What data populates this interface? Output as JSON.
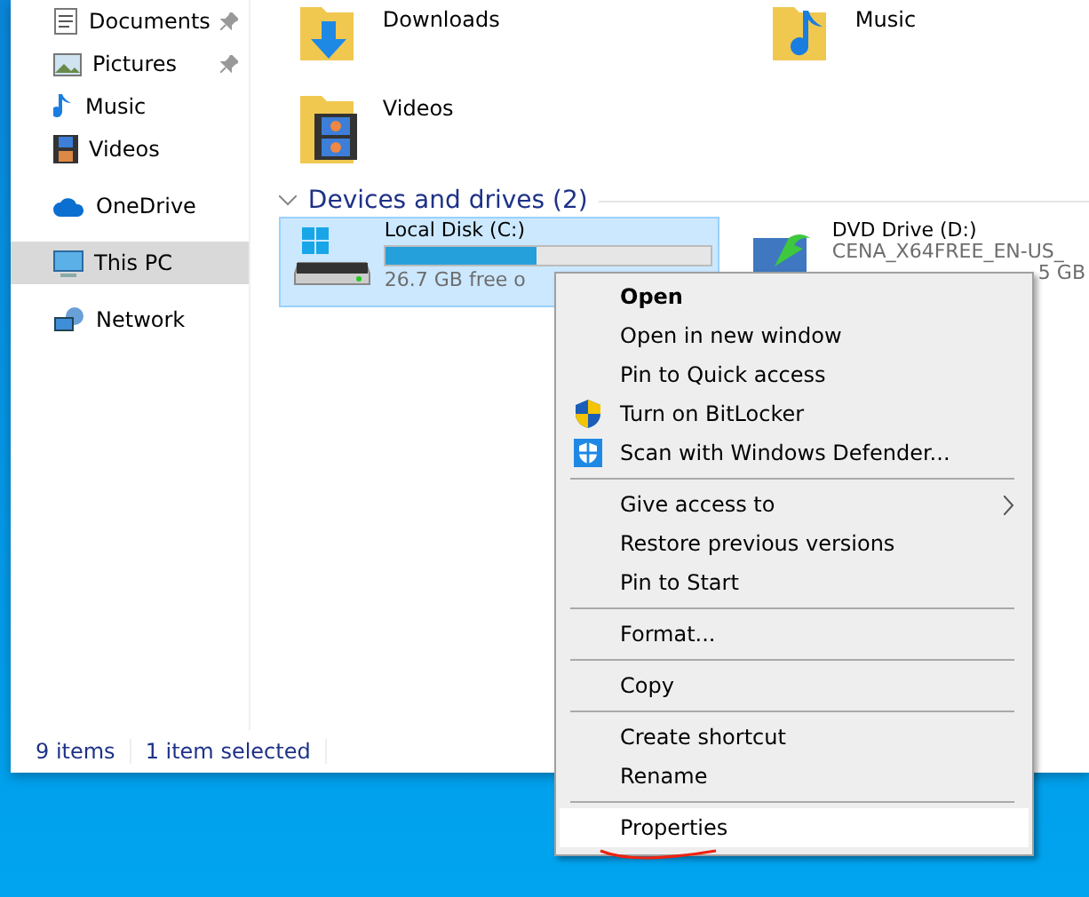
{
  "sidebar": {
    "items": [
      {
        "label": "Documents",
        "kind": "quick",
        "pinned": true,
        "selected": false
      },
      {
        "label": "Pictures",
        "kind": "quick",
        "pinned": true,
        "selected": false
      },
      {
        "label": "Music",
        "kind": "quick",
        "pinned": false,
        "selected": false
      },
      {
        "label": "Videos",
        "kind": "quick",
        "pinned": false,
        "selected": false
      },
      {
        "label": "OneDrive",
        "kind": "root",
        "pinned": false,
        "selected": false
      },
      {
        "label": "This PC",
        "kind": "root",
        "pinned": false,
        "selected": true
      },
      {
        "label": "Network",
        "kind": "root",
        "pinned": false,
        "selected": false
      }
    ]
  },
  "folders": [
    {
      "label": "Downloads"
    },
    {
      "label": "Music"
    },
    {
      "label": "Videos"
    }
  ],
  "devices": {
    "header": "Devices and drives (2)",
    "drives": [
      {
        "name": "Local Disk (C:)",
        "selected": true,
        "level": 0.46,
        "lines": [
          "26.7 GB free o"
        ]
      },
      {
        "name": "DVD Drive (D:)",
        "selected": false,
        "lines": [
          "CENA_X64FREE_EN-US_",
          "5 GB"
        ]
      }
    ]
  },
  "status_bar": {
    "count": "9 items",
    "selection": "1 item selected"
  },
  "context_menu": [
    {
      "kind": "item",
      "label": "Open",
      "bold": true
    },
    {
      "kind": "item",
      "label": "Open in new window"
    },
    {
      "kind": "item",
      "label": "Pin to Quick access"
    },
    {
      "kind": "item",
      "label": "Turn on BitLocker"
    },
    {
      "kind": "item",
      "label": "Scan with Windows Defender..."
    },
    {
      "kind": "separator"
    },
    {
      "kind": "item",
      "label": "Give access to",
      "submenu": true
    },
    {
      "kind": "item",
      "label": "Restore previous versions"
    },
    {
      "kind": "item",
      "label": "Pin to Start"
    },
    {
      "kind": "separator"
    },
    {
      "kind": "item",
      "label": "Format..."
    },
    {
      "kind": "separator"
    },
    {
      "kind": "item",
      "label": "Copy"
    },
    {
      "kind": "separator"
    },
    {
      "kind": "item",
      "label": "Create shortcut"
    },
    {
      "kind": "item",
      "label": "Rename"
    },
    {
      "kind": "separator"
    },
    {
      "kind": "item",
      "label": "Properties",
      "highlighted": true,
      "underlined": true
    }
  ]
}
